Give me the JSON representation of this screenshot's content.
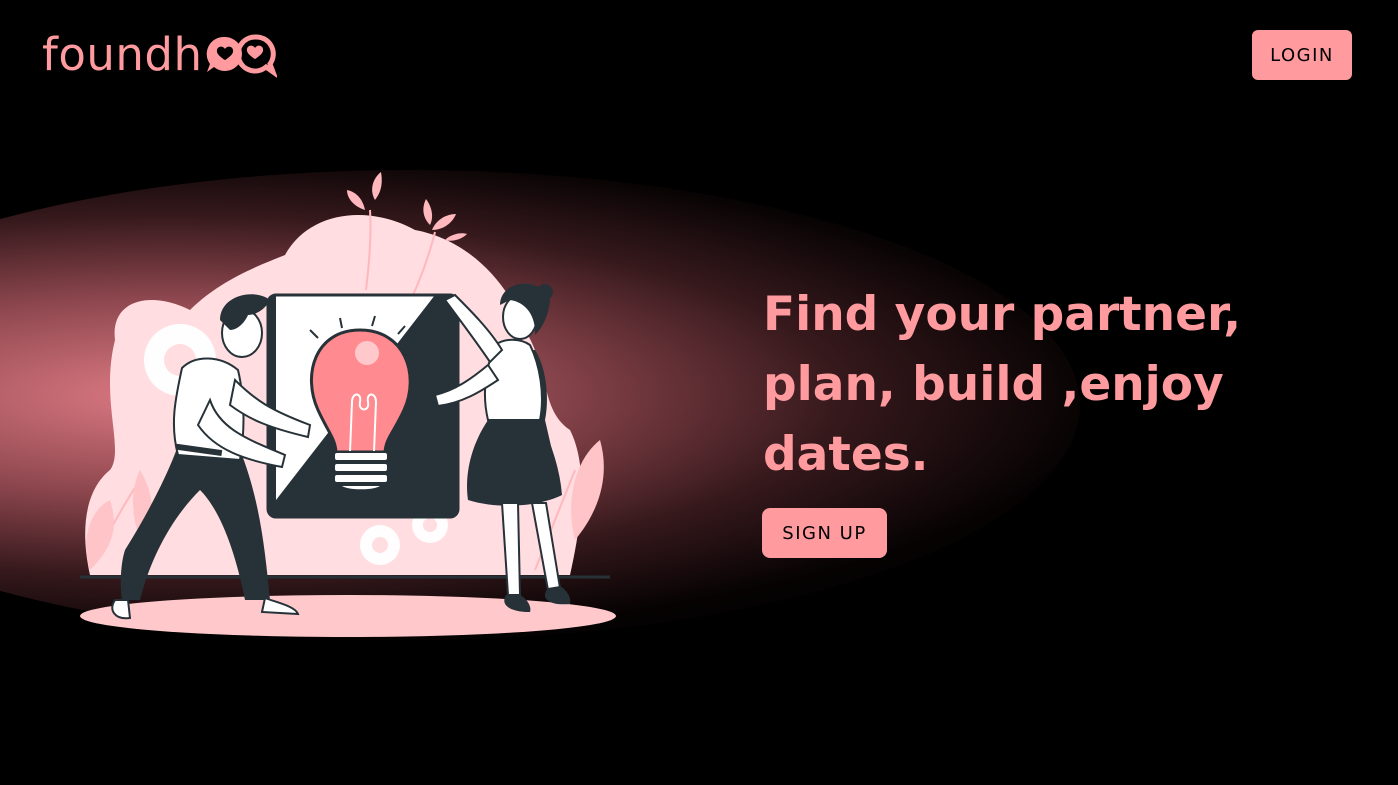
{
  "brand": {
    "name": "foundh",
    "accent_color": "#ff9a9e",
    "logo_icon": "heart-chat-bubbles-icon"
  },
  "header": {
    "login_label": "LOGIN"
  },
  "hero": {
    "headline": "Find your partner, plan, build ,enjoy dates.",
    "signup_label": "SIGN UP",
    "illustration_icon": "couple-holding-lightbulb-illustration"
  },
  "colors": {
    "background": "#000000",
    "accent": "#ff9a9e",
    "dark": "#263238",
    "blush": "#ffd6da"
  }
}
